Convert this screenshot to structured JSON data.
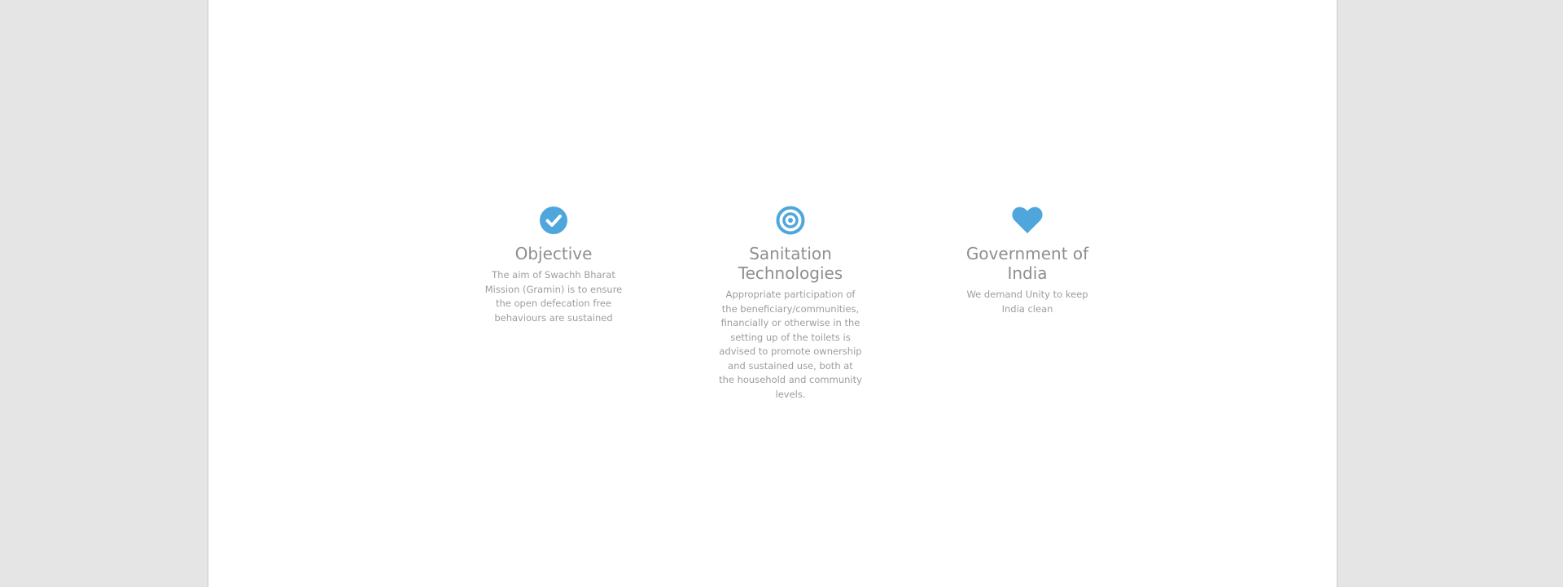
{
  "colors": {
    "accent": "#4ea6dc",
    "title": "#8f8f8f",
    "text": "#9d9d9d",
    "page": "#ffffff",
    "background": "#e5e5e5"
  },
  "features": [
    {
      "icon": "check-circle-icon",
      "title": "Objective",
      "text": "The aim of Swachh Bharat Mission (Gramin) is to ensure the open defecation free behaviours are sustained"
    },
    {
      "icon": "target-icon",
      "title": "Sanitation Technologies",
      "text": "Appropriate participation of the beneficiary/communities, financially or otherwise in the setting up of the toilets is advised to promote ownership and sustained use, both at the household and community levels."
    },
    {
      "icon": "heart-icon",
      "title": "Government of India",
      "text": "We demand Unity to keep India clean"
    }
  ]
}
